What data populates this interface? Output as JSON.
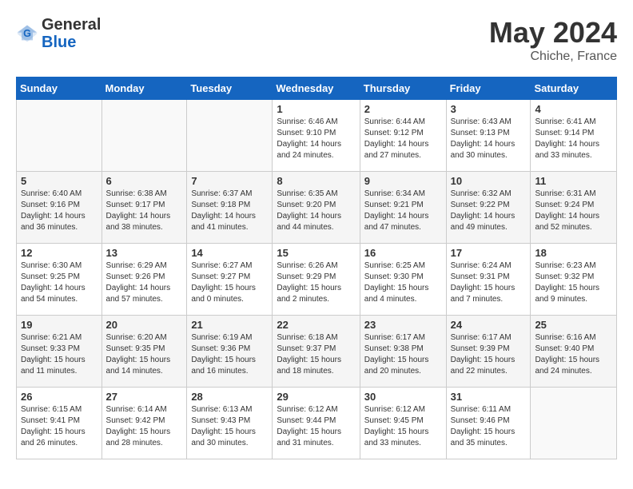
{
  "header": {
    "logo_general": "General",
    "logo_blue": "Blue",
    "title": "May 2024",
    "location": "Chiche, France"
  },
  "days_of_week": [
    "Sunday",
    "Monday",
    "Tuesday",
    "Wednesday",
    "Thursday",
    "Friday",
    "Saturday"
  ],
  "weeks": [
    [
      {
        "num": "",
        "info": ""
      },
      {
        "num": "",
        "info": ""
      },
      {
        "num": "",
        "info": ""
      },
      {
        "num": "1",
        "info": "Sunrise: 6:46 AM\nSunset: 9:10 PM\nDaylight: 14 hours\nand 24 minutes."
      },
      {
        "num": "2",
        "info": "Sunrise: 6:44 AM\nSunset: 9:12 PM\nDaylight: 14 hours\nand 27 minutes."
      },
      {
        "num": "3",
        "info": "Sunrise: 6:43 AM\nSunset: 9:13 PM\nDaylight: 14 hours\nand 30 minutes."
      },
      {
        "num": "4",
        "info": "Sunrise: 6:41 AM\nSunset: 9:14 PM\nDaylight: 14 hours\nand 33 minutes."
      }
    ],
    [
      {
        "num": "5",
        "info": "Sunrise: 6:40 AM\nSunset: 9:16 PM\nDaylight: 14 hours\nand 36 minutes."
      },
      {
        "num": "6",
        "info": "Sunrise: 6:38 AM\nSunset: 9:17 PM\nDaylight: 14 hours\nand 38 minutes."
      },
      {
        "num": "7",
        "info": "Sunrise: 6:37 AM\nSunset: 9:18 PM\nDaylight: 14 hours\nand 41 minutes."
      },
      {
        "num": "8",
        "info": "Sunrise: 6:35 AM\nSunset: 9:20 PM\nDaylight: 14 hours\nand 44 minutes."
      },
      {
        "num": "9",
        "info": "Sunrise: 6:34 AM\nSunset: 9:21 PM\nDaylight: 14 hours\nand 47 minutes."
      },
      {
        "num": "10",
        "info": "Sunrise: 6:32 AM\nSunset: 9:22 PM\nDaylight: 14 hours\nand 49 minutes."
      },
      {
        "num": "11",
        "info": "Sunrise: 6:31 AM\nSunset: 9:24 PM\nDaylight: 14 hours\nand 52 minutes."
      }
    ],
    [
      {
        "num": "12",
        "info": "Sunrise: 6:30 AM\nSunset: 9:25 PM\nDaylight: 14 hours\nand 54 minutes."
      },
      {
        "num": "13",
        "info": "Sunrise: 6:29 AM\nSunset: 9:26 PM\nDaylight: 14 hours\nand 57 minutes."
      },
      {
        "num": "14",
        "info": "Sunrise: 6:27 AM\nSunset: 9:27 PM\nDaylight: 15 hours\nand 0 minutes."
      },
      {
        "num": "15",
        "info": "Sunrise: 6:26 AM\nSunset: 9:29 PM\nDaylight: 15 hours\nand 2 minutes."
      },
      {
        "num": "16",
        "info": "Sunrise: 6:25 AM\nSunset: 9:30 PM\nDaylight: 15 hours\nand 4 minutes."
      },
      {
        "num": "17",
        "info": "Sunrise: 6:24 AM\nSunset: 9:31 PM\nDaylight: 15 hours\nand 7 minutes."
      },
      {
        "num": "18",
        "info": "Sunrise: 6:23 AM\nSunset: 9:32 PM\nDaylight: 15 hours\nand 9 minutes."
      }
    ],
    [
      {
        "num": "19",
        "info": "Sunrise: 6:21 AM\nSunset: 9:33 PM\nDaylight: 15 hours\nand 11 minutes."
      },
      {
        "num": "20",
        "info": "Sunrise: 6:20 AM\nSunset: 9:35 PM\nDaylight: 15 hours\nand 14 minutes."
      },
      {
        "num": "21",
        "info": "Sunrise: 6:19 AM\nSunset: 9:36 PM\nDaylight: 15 hours\nand 16 minutes."
      },
      {
        "num": "22",
        "info": "Sunrise: 6:18 AM\nSunset: 9:37 PM\nDaylight: 15 hours\nand 18 minutes."
      },
      {
        "num": "23",
        "info": "Sunrise: 6:17 AM\nSunset: 9:38 PM\nDaylight: 15 hours\nand 20 minutes."
      },
      {
        "num": "24",
        "info": "Sunrise: 6:17 AM\nSunset: 9:39 PM\nDaylight: 15 hours\nand 22 minutes."
      },
      {
        "num": "25",
        "info": "Sunrise: 6:16 AM\nSunset: 9:40 PM\nDaylight: 15 hours\nand 24 minutes."
      }
    ],
    [
      {
        "num": "26",
        "info": "Sunrise: 6:15 AM\nSunset: 9:41 PM\nDaylight: 15 hours\nand 26 minutes."
      },
      {
        "num": "27",
        "info": "Sunrise: 6:14 AM\nSunset: 9:42 PM\nDaylight: 15 hours\nand 28 minutes."
      },
      {
        "num": "28",
        "info": "Sunrise: 6:13 AM\nSunset: 9:43 PM\nDaylight: 15 hours\nand 30 minutes."
      },
      {
        "num": "29",
        "info": "Sunrise: 6:12 AM\nSunset: 9:44 PM\nDaylight: 15 hours\nand 31 minutes."
      },
      {
        "num": "30",
        "info": "Sunrise: 6:12 AM\nSunset: 9:45 PM\nDaylight: 15 hours\nand 33 minutes."
      },
      {
        "num": "31",
        "info": "Sunrise: 6:11 AM\nSunset: 9:46 PM\nDaylight: 15 hours\nand 35 minutes."
      },
      {
        "num": "",
        "info": ""
      }
    ]
  ]
}
